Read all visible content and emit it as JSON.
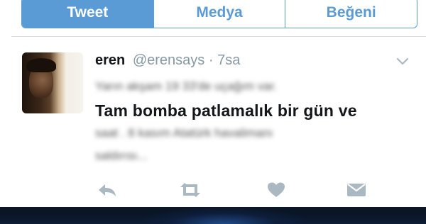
{
  "tabs": [
    {
      "label": "Tweet"
    },
    {
      "label": "Medya"
    },
    {
      "label": "Beğeni"
    }
  ],
  "tweet": {
    "name": "eren",
    "handle": "@erensays",
    "separator": "·",
    "time": "7sa",
    "line1": "Yarın akşam 19 33'de uçağım var.",
    "line2": "Tam bomba patlamalık bir gün ve",
    "line3": "saat . 8 kasım Atatürk havalimanı",
    "line4": "saldırısı..."
  },
  "colors": {
    "accent": "#5b9bd5",
    "muted": "#8899a6",
    "icon": "#aab8c2"
  },
  "icons": [
    "chevron-down-icon",
    "reply-icon",
    "retweet-icon",
    "heart-icon",
    "message-icon"
  ]
}
